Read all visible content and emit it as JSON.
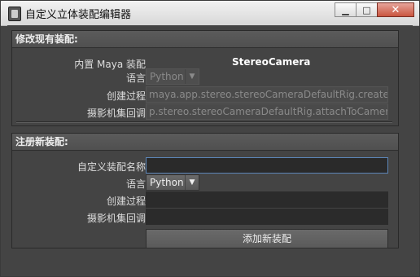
{
  "window": {
    "title": "自定义立体装配编辑器",
    "controls": {
      "minimize": "▁",
      "maximize": "□",
      "close": "✕"
    }
  },
  "modify_panel": {
    "header": "修改现有装配:",
    "builtin_label": "内置 Maya 装配",
    "builtin_value": "StereoCamera",
    "language_label": "语言",
    "language_value": "Python",
    "create_proc_label": "创建过程",
    "create_proc_value": "maya.app.stereo.stereoCameraDefaultRig.createRig",
    "camera_callback_label": "摄影机集回调",
    "camera_callback_value": "p.stereo.stereoCameraDefaultRig.attachToCameraSet"
  },
  "register_panel": {
    "header": "注册新装配:",
    "custom_name_label": "自定义装配名称",
    "custom_name_value": "",
    "language_label": "语言",
    "language_value": "Python",
    "create_proc_label": "创建过程",
    "create_proc_value": "",
    "camera_callback_label": "摄影机集回调",
    "camera_callback_value": "",
    "add_button": "添加新装配"
  }
}
